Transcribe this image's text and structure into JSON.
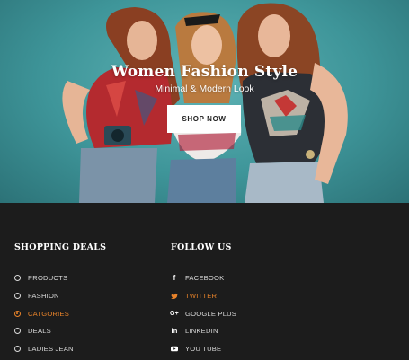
{
  "hero": {
    "title": "Women Fashion Style",
    "subtitle": "Minimal & Modern Look",
    "button_label": "SHOP NOW",
    "background_color": "#3e9599"
  },
  "footer": {
    "shopping": {
      "title": "SHOPPING DEALS",
      "items": [
        {
          "label": "PRODUCTS",
          "icon": "circle-icon",
          "active": false
        },
        {
          "label": "FASHION",
          "icon": "circle-icon",
          "active": false
        },
        {
          "label": "CATGORIES",
          "icon": "circle-icon",
          "active": true
        },
        {
          "label": "DEALS",
          "icon": "circle-icon",
          "active": false
        },
        {
          "label": "LADIES JEAN",
          "icon": "circle-icon",
          "active": false
        }
      ]
    },
    "follow": {
      "title": "FOLLOW US",
      "items": [
        {
          "label": "FACEBOOK",
          "icon": "facebook-icon",
          "active": false
        },
        {
          "label": "TWITTER",
          "icon": "twitter-icon",
          "active": true
        },
        {
          "label": "GOOGLE PLUS",
          "icon": "google-plus-icon",
          "active": false
        },
        {
          "label": "LINKEDIN",
          "icon": "linkedin-icon",
          "active": false
        },
        {
          "label": "YOU TUBE",
          "icon": "youtube-icon",
          "active": false
        }
      ]
    },
    "accent_color": "#e8832a",
    "background_color": "#1c1c1c"
  }
}
